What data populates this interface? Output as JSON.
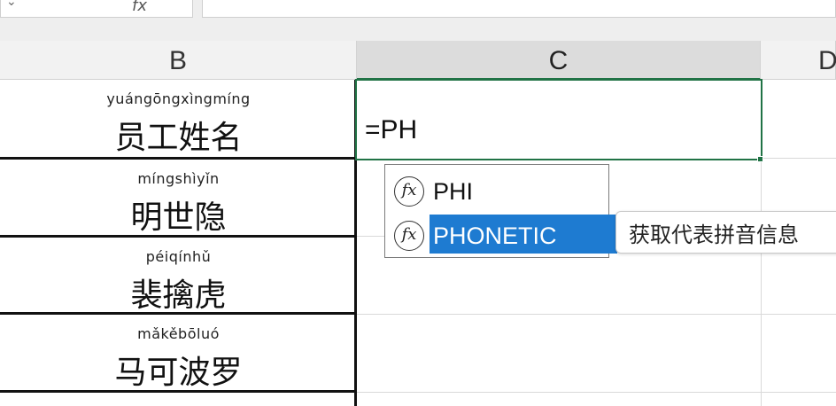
{
  "formula_bar": {
    "fx_glyph": "fx",
    "formula_text": ""
  },
  "column_headers": {
    "b": "B",
    "c": "C",
    "d": "D"
  },
  "rows": [
    {
      "pinyin": "yuángōngxìngmíng",
      "text": "员工姓名"
    },
    {
      "pinyin": "míngshìyǐn",
      "text": "明世隐"
    },
    {
      "pinyin": "péiqínhǔ",
      "text": "裴擒虎"
    },
    {
      "pinyin": "mǎkěbōluó",
      "text": "马可波罗"
    }
  ],
  "active_cell": {
    "input_text": "=PH",
    "accent": "#217346"
  },
  "autocomplete": {
    "items": [
      {
        "label": "PHI",
        "icon": "function-fx-icon",
        "selected": false
      },
      {
        "label": "PHONETIC",
        "icon": "function-fx-icon",
        "selected": true
      }
    ],
    "tooltip": "获取代表拼音信息",
    "selected_color": "#1e7bd1"
  }
}
